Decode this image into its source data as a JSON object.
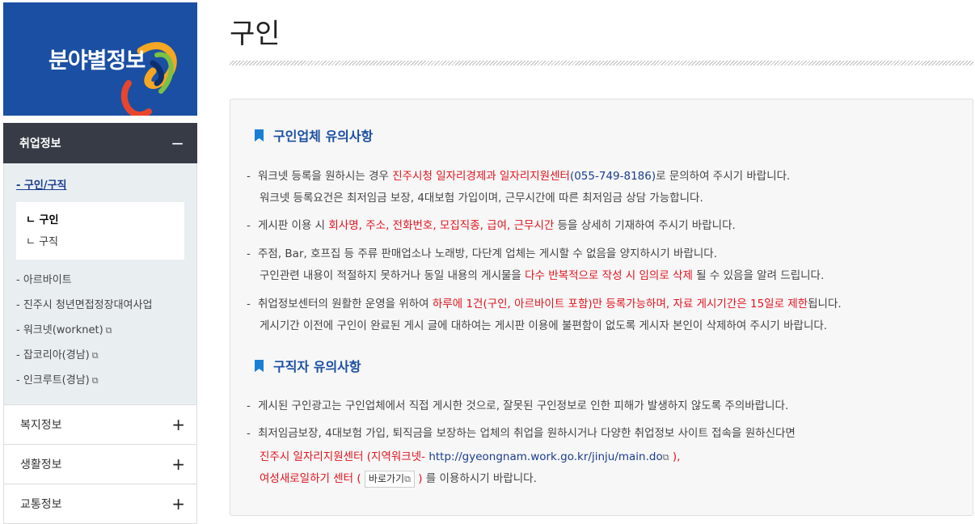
{
  "sidebar": {
    "banner_title": "분야별정보",
    "menu_head": {
      "label": "취업정보",
      "toggle": "−"
    },
    "active_item": "- 구인/구직",
    "subsub": [
      "ㄴ 구인",
      "ㄴ 구직"
    ],
    "items": [
      {
        "label": "- 아르바이트",
        "ext": ""
      },
      {
        "label": "- 진주시 청년면접정장대여사업",
        "ext": ""
      },
      {
        "label": "- 워크넷(worknet)",
        "ext": "⧉"
      },
      {
        "label": "- 잡코리아(경남)",
        "ext": "⧉"
      },
      {
        "label": "- 인크루트(경남)",
        "ext": "⧉"
      }
    ],
    "menus": [
      {
        "label": "복지정보",
        "toggle": "+"
      },
      {
        "label": "생활정보",
        "toggle": "+"
      },
      {
        "label": "교통정보",
        "toggle": "+"
      }
    ]
  },
  "page": {
    "title": "구인"
  },
  "notice": {
    "sec1_title": "구인업체 유의사항",
    "l1a": "워크넷 등록을 원하시는 경우 ",
    "l1b": "진주시청 일자리경제과 일자리지원센터",
    "l1c": "(055-749-8186)",
    "l1d": "로 문의하여 주시기 바랍니다.",
    "l2": "워크넷 등록요건은 최저임금 보장, 4대보험 가입이며, 근무시간에 따른 최저임금 상담 가능합니다.",
    "l3a": "게시판 이용 시 ",
    "l3b": "회사명, 주소, 전화번호, 모집직종, 급여, 근무시간",
    "l3c": " 등을 상세히 기재하여 주시기 바랍니다.",
    "l4": "주점, Bar, 호프집 등 주류 판매업소나 노래방, 다단계 업체는 게시할 수 없음을 양지하시기 바랍니다.",
    "l5a": "구인관련 내용이 적절하지 못하거나 동일 내용의 게시물을 ",
    "l5b": "다수 반복적으로 작성 시 임의로 삭제",
    "l5c": " 될 수 있음을 알려 드립니다.",
    "l6a": "취업정보센터의 원활한 운영을 위하여 ",
    "l6b": "하루에 1건(구인, 아르바이트 포함)만 등록가능하며, 자료 게시기간은 15일로 제한",
    "l6c": "됩니다.",
    "l7": "게시기간 이전에 구인이 완료된 게시 글에 대하여는 게시판 이용에 불편함이 없도록 게시자 본인이 삭제하여 주시기 바랍니다.",
    "sec2_title": "구직자 유의사항",
    "l8": "게시된 구인광고는 구인업체에서 직접 게시한 것으로, 잘못된 구인정보로 인한 피해가 발생하지 않도록 주의바랍니다.",
    "l9": "최저임금보장, 4대보험 가입, 퇴직금을 보장하는 업체의 취업을 원하시거나 다양한 취업정보 사이트 접속을 원하신다면",
    "l10a": "진주시 일자리지원센터 (지역워크넷- ",
    "l10_url": "http://gyeongnam.work.go.kr/jinju/main.do",
    "l10c": " ),",
    "l11a": "여성새로일하기 센터 ( ",
    "l11_btn": "바로가기",
    "l11c": " )",
    "l11d": " 를 이용하시기 바랍니다.",
    "ext_icon": "⧉"
  }
}
